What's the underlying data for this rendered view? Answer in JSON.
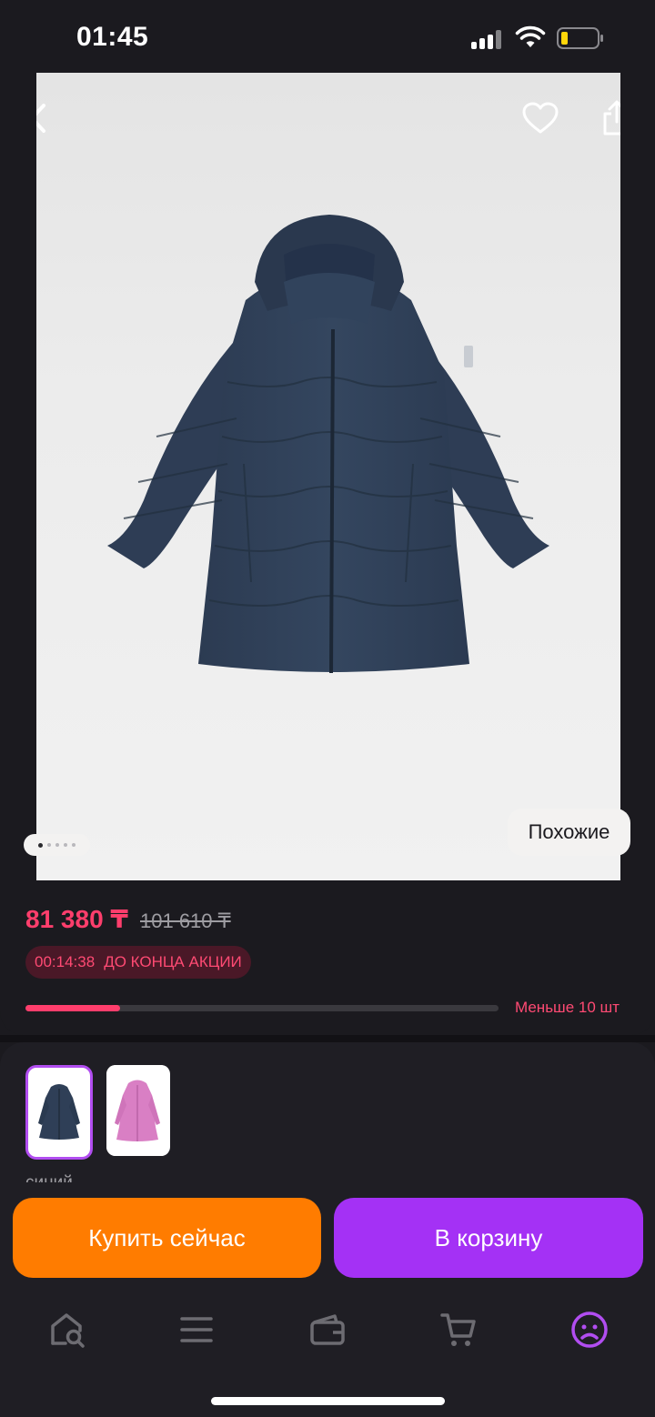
{
  "status_bar": {
    "time": "01:45"
  },
  "product": {
    "similar_label": "Похожие",
    "gallery_count": 5,
    "gallery_index": 1
  },
  "pricing": {
    "current_price": "81 380 ₸",
    "old_price": "101 610 ₸",
    "timer": "00:14:38",
    "promo_text": "ДО КОНЦА АКЦИИ",
    "stock_label": "Меньше 10 шт",
    "stock_fraction": 0.2
  },
  "variants": {
    "selected_color": "синий",
    "items": [
      {
        "color": "синий",
        "selected": true
      },
      {
        "color": "розовый",
        "selected": false
      }
    ]
  },
  "actions": {
    "buy_now": "Купить сейчас",
    "add_to_cart": "В корзину"
  },
  "tabbar": {
    "items": [
      {
        "icon": "home-search-icon",
        "active": false
      },
      {
        "icon": "menu-icon",
        "active": false
      },
      {
        "icon": "wallet-icon",
        "active": false
      },
      {
        "icon": "cart-icon",
        "active": false
      },
      {
        "icon": "profile-icon",
        "active": true
      }
    ]
  },
  "colors": {
    "accent_pink": "#ff3e6c",
    "accent_purple": "#a431f5",
    "accent_orange": "#ff7c00",
    "background": "#1b1a1f"
  }
}
